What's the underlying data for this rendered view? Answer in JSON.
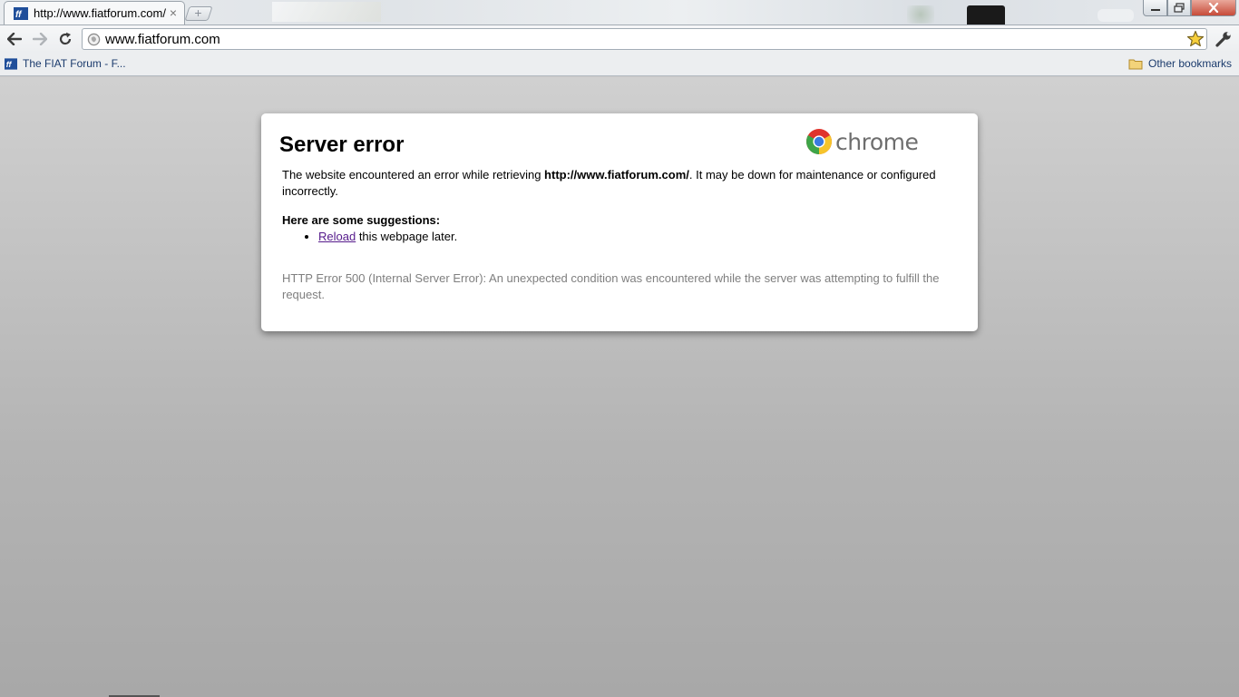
{
  "tab": {
    "title": "http://www.fiatforum.com/",
    "favicon": "fiat-forum-favicon",
    "close_glyph": "×"
  },
  "new_tab_glyph": "+",
  "window_controls": {
    "minimize": "‒",
    "maximize": "❐",
    "close": "✕"
  },
  "toolbar": {
    "back_icon": "back-arrow-icon",
    "forward_icon": "forward-arrow-icon",
    "reload_icon": "reload-icon",
    "url": "www.fiatforum.com"
  },
  "bookmarks": {
    "left_item": "The FIAT Forum - F...",
    "right_item": "Other bookmarks"
  },
  "error": {
    "title": "Server error",
    "logo_text": "chrome",
    "msg_before": "The website encountered an error while retrieving ",
    "msg_url": "http://www.fiatforum.com/",
    "msg_after": ". It may be down for maintenance or configured incorrectly.",
    "suggestions_heading": "Here are some suggestions:",
    "suggestion_link": "Reload",
    "suggestion_rest": " this webpage later.",
    "details": "HTTP Error 500 (Internal Server Error): An unexpected condition was encountered while the server was attempting to fulfill the request."
  },
  "colors": {
    "link_visited": "#551a8b",
    "details_text": "#7f7f7f",
    "bookmark_text": "#1a3a6c",
    "close_button": "#c74b39"
  }
}
